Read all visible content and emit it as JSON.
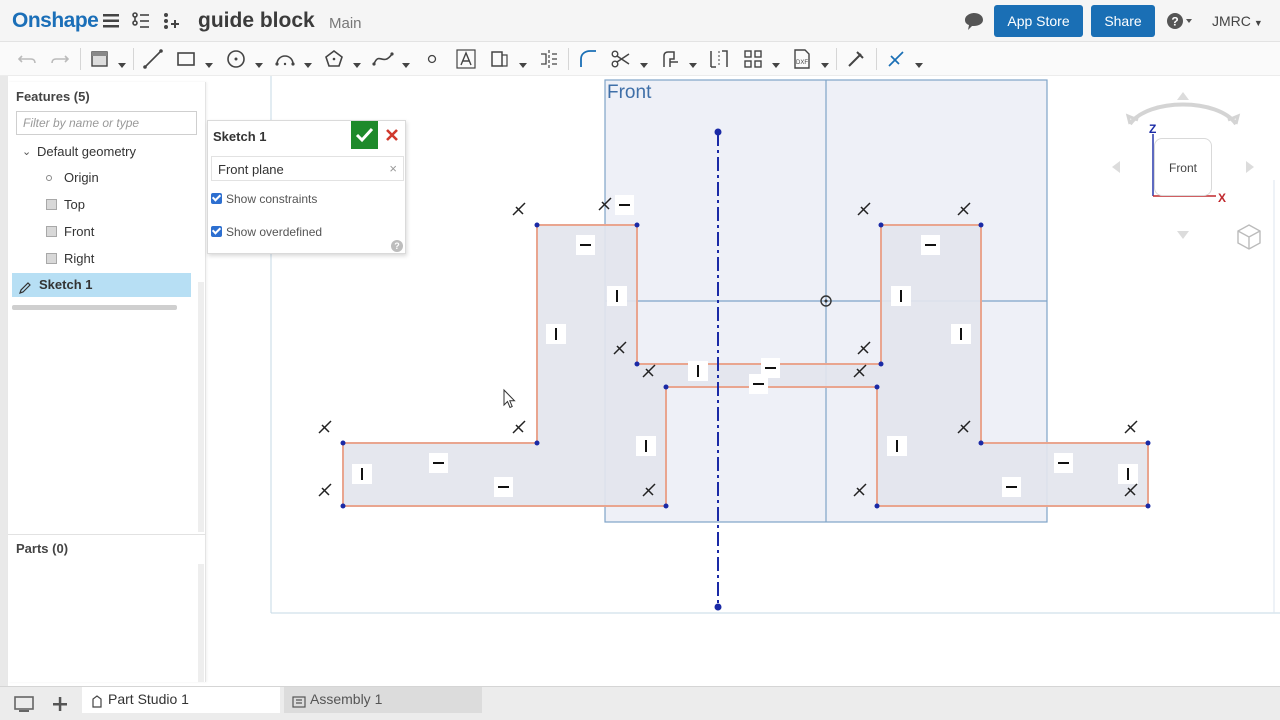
{
  "app": {
    "logo": "Onshape",
    "document_title": "guide block",
    "workspace": "Main"
  },
  "header": {
    "app_store": "App Store",
    "share": "Share",
    "user": "JMRC"
  },
  "feature_list": {
    "title": "Features (5)",
    "filter_placeholder": "Filter by name or type",
    "group": "Default geometry",
    "items": [
      {
        "label": "Origin",
        "icon": "origin-icon"
      },
      {
        "label": "Top",
        "icon": "plane-icon"
      },
      {
        "label": "Front",
        "icon": "plane-icon"
      },
      {
        "label": "Right",
        "icon": "plane-icon"
      },
      {
        "label": "Sketch 1",
        "icon": "sketch-icon",
        "selected": true
      }
    ],
    "parts_title": "Parts (0)"
  },
  "sketch_dialog": {
    "title": "Sketch 1",
    "plane": "Front plane",
    "show_constraints": "Show constraints",
    "show_overdefined": "Show overdefined",
    "show_constraints_checked": true,
    "show_overdefined_checked": true
  },
  "viewport": {
    "plane_label": "Front",
    "viewcube": {
      "face": "Front",
      "axis_z": "Z",
      "axis_x": "X"
    },
    "colors": {
      "plane_fill": "#eef0f7",
      "plane_edge": "#7fa3c8",
      "profile_fill": "#e3e5ed",
      "profile_edge": "#e9a58f",
      "centerline": "#1a2aa6"
    }
  },
  "tabs": [
    {
      "label": "Part Studio 1",
      "active": true
    },
    {
      "label": "Assembly 1",
      "active": false
    }
  ]
}
